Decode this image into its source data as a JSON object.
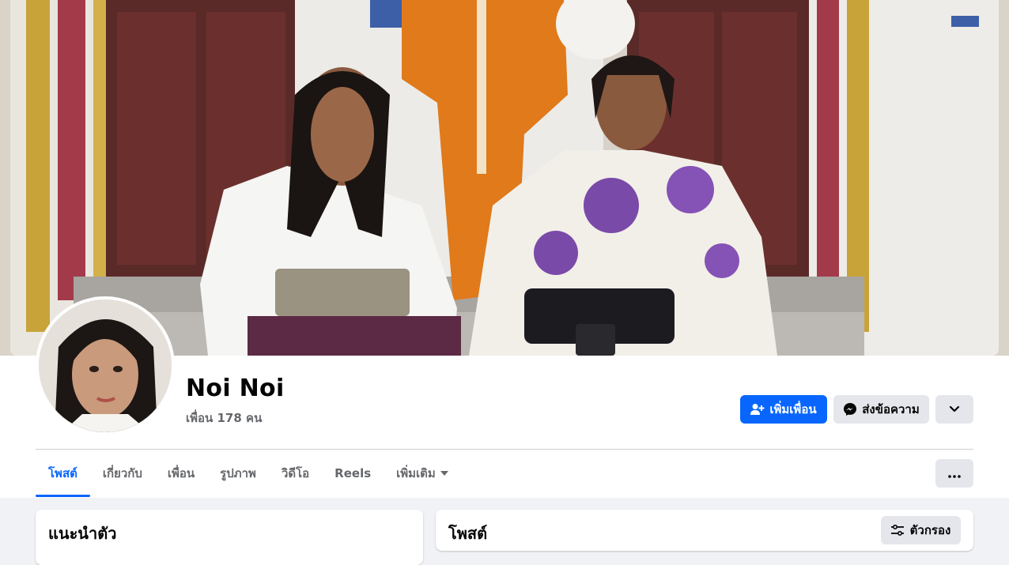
{
  "profile": {
    "name": "Noi Noi",
    "friends_text": "เพื่อน 178 คน"
  },
  "actions": {
    "add_friend_label": "เพิ่มเพื่อน",
    "message_label": "ส่งข้อความ",
    "more_icon": "chevron-down-icon",
    "add_friend_icon": "add-friend-icon",
    "message_icon": "messenger-icon"
  },
  "tabs": [
    {
      "label": "โพสต์",
      "active": true
    },
    {
      "label": "เกี่ยวกับ",
      "active": false
    },
    {
      "label": "เพื่อน",
      "active": false
    },
    {
      "label": "รูปภาพ",
      "active": false
    },
    {
      "label": "วิดีโอ",
      "active": false
    },
    {
      "label": "Reels",
      "active": false
    },
    {
      "label": "เพิ่มเติม",
      "active": false
    }
  ],
  "intro": {
    "title": "แนะนำตัว"
  },
  "posts": {
    "title": "โพสต์",
    "filter_label": "ตัวกรอง",
    "filter_icon": "filter-sliders-icon"
  },
  "colors": {
    "accent": "#0866ff",
    "secondary_button": "#e4e6eb",
    "page_bg": "#f0f2f5",
    "muted_text": "#65676b"
  }
}
